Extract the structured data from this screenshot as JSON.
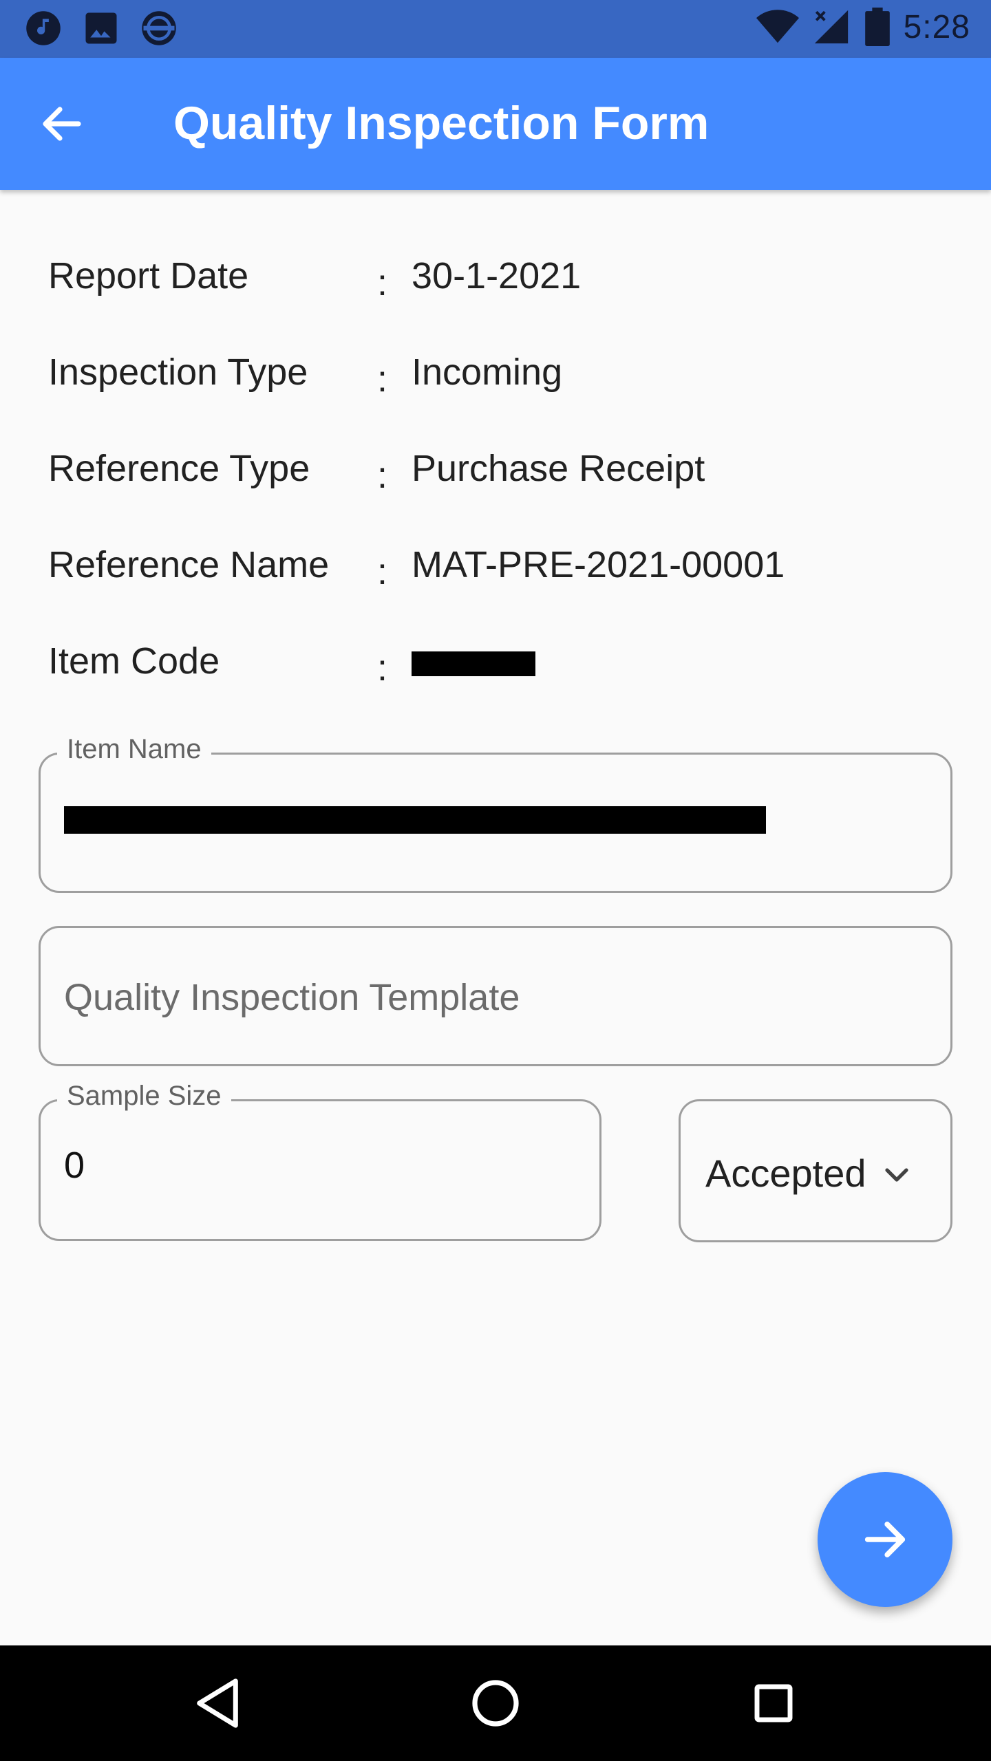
{
  "status_bar": {
    "time": "5:28",
    "left_icons": [
      "music-icon",
      "image-icon",
      "subway-icon"
    ],
    "right_icons": [
      "wifi-icon",
      "signal-icon",
      "battery-icon"
    ]
  },
  "app_bar": {
    "title": "Quality Inspection Form",
    "back_icon": "arrow-left-icon"
  },
  "details": [
    {
      "label": "Report Date",
      "separator": ":",
      "value": "30-1-2021"
    },
    {
      "label": "Inspection Type",
      "separator": ":",
      "value": "Incoming"
    },
    {
      "label": "Reference Type",
      "separator": ":",
      "value": "Purchase Receipt"
    },
    {
      "label": "Reference Name",
      "separator": ":",
      "value": "MAT-PRE-2021-00001"
    },
    {
      "label": "Item Code",
      "separator": ":",
      "value": ""
    }
  ],
  "form": {
    "item_name": {
      "label": "Item Name",
      "value": ""
    },
    "template": {
      "placeholder": "Quality Inspection Template"
    },
    "sample_size": {
      "label": "Sample Size",
      "value": "0"
    },
    "status": {
      "selected": "Accepted"
    }
  },
  "fab": {
    "icon": "arrow-right-icon"
  },
  "nav_bar": {
    "icons": [
      "back-triangle-icon",
      "home-circle-icon",
      "recents-square-icon"
    ]
  },
  "colors": {
    "primary": "#448aff",
    "status_bar": "#3867c2",
    "background": "#fafafa"
  }
}
